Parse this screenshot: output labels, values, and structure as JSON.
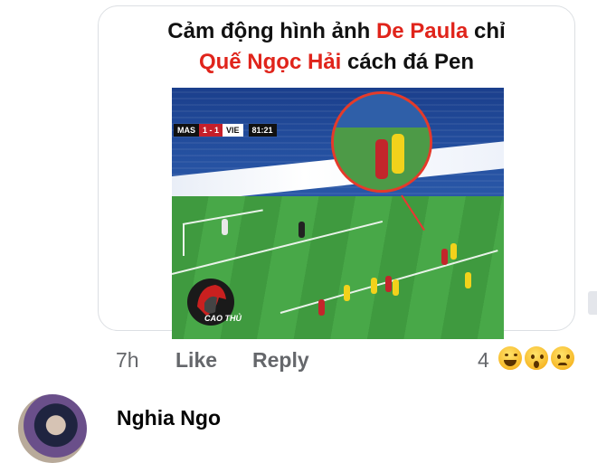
{
  "post_image": {
    "headline_line1_prefix": "Cảm động hình ảnh ",
    "headline_line1_highlight": "De Paula",
    "headline_line1_suffix": " chỉ",
    "headline_line2_highlight": "Quế Ngọc Hải",
    "headline_line2_suffix": " cách đá Pen",
    "scoreboard": {
      "home": "MAS",
      "score": "1 - 1",
      "away": "VIE",
      "clock": "81:21"
    },
    "watermark": "CAO THỦ",
    "accent_red": "#e0241b"
  },
  "comment_meta": {
    "time": "7h",
    "like_label": "Like",
    "reply_label": "Reply",
    "reaction_count": "4",
    "reactions": [
      "haha-emoji-icon",
      "wow-emoji-icon",
      "sad-emoji-icon"
    ]
  },
  "next_comment": {
    "author": "Nghia Ngo"
  }
}
